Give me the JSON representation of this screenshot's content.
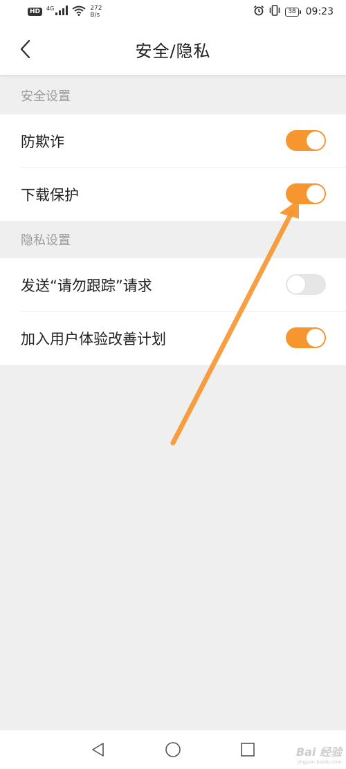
{
  "status_bar": {
    "hd": "HD",
    "network": "4G",
    "speed_value": "272",
    "speed_unit": "B/s",
    "battery": "38",
    "time": "09:23",
    "icons": [
      "hd-icon",
      "signal-icon",
      "wifi-icon",
      "alarm-icon",
      "vibrate-icon",
      "battery-icon"
    ]
  },
  "header": {
    "title": "安全/隐私",
    "back_icon": "back-chevron-icon"
  },
  "sections": [
    {
      "title": "安全设置",
      "items": [
        {
          "label": "防欺诈",
          "toggle_on": true
        },
        {
          "label": "下载保护",
          "toggle_on": true
        }
      ]
    },
    {
      "title": "隐私设置",
      "items": [
        {
          "label": "发送“请勿跟踪”请求",
          "toggle_on": false
        },
        {
          "label": "加入用户体验改善计划",
          "toggle_on": true
        }
      ]
    }
  ],
  "colors": {
    "accent": "#f7952e",
    "toggle_off": "#e6e6e6",
    "annotation_arrow": "#f7952e"
  },
  "nav_bar": {
    "icons": [
      "back-triangle-icon",
      "home-circle-icon",
      "recents-square-icon"
    ]
  },
  "watermark": {
    "text": "Bai 经验",
    "sub": "jingyan.baidu.com"
  }
}
